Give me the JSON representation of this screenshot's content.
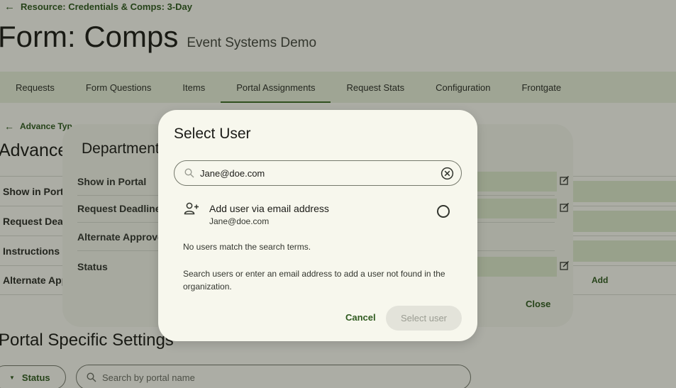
{
  "header": {
    "back_label": "Resource: Credentials & Comps: 3-Day",
    "title": "Form: Comps",
    "subtitle": "Event Systems Demo"
  },
  "tabs": [
    {
      "label": "Requests",
      "active": false
    },
    {
      "label": "Form Questions",
      "active": false
    },
    {
      "label": "Items",
      "active": false
    },
    {
      "label": "Portal Assignments",
      "active": true
    },
    {
      "label": "Request Stats",
      "active": false
    },
    {
      "label": "Configuration",
      "active": false
    },
    {
      "label": "Frontgate",
      "active": false
    }
  ],
  "section": {
    "back_label": "Advance Typ",
    "title": "Advance",
    "rows": [
      "Show in Port",
      "Request Dea",
      "Instructions",
      "Alternate App"
    ],
    "add_label": "Add"
  },
  "portal": {
    "title": "Portal Specific Settings",
    "status_label": "Status",
    "search_placeholder": "Search by portal name"
  },
  "dept_dialog": {
    "title": "Department",
    "rows": [
      "Show in Portal",
      "Request Deadline",
      "Alternate Approve",
      "Status"
    ],
    "close_label": "Close"
  },
  "user_dialog": {
    "title": "Select User",
    "search_value": "Jane@doe.com",
    "option_title": "Add user via email address",
    "option_email": "Jane@doe.com",
    "no_match": "No users match the search terms.",
    "help": "Search users or enter an email address to add a user not found in the organization.",
    "cancel_label": "Cancel",
    "select_label": "Select user"
  },
  "colors": {
    "accent": "#2f5a1f",
    "tab_bar": "#e7efd9",
    "field": "#dde8cc",
    "surface": "#f7f7ed"
  }
}
